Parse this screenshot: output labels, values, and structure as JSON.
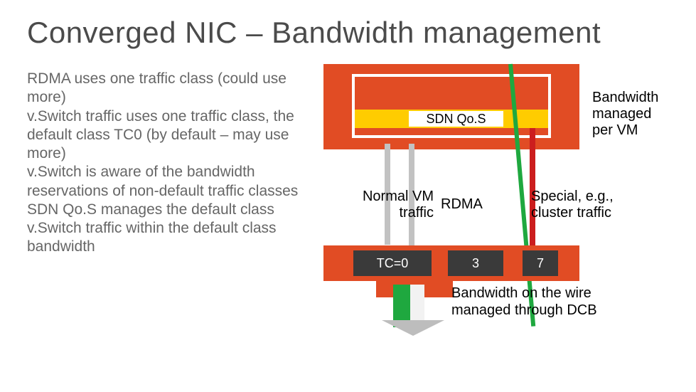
{
  "title": "Converged NIC – Bandwidth management",
  "body": {
    "p1": "RDMA uses one traffic class (could use more)",
    "p2": "v.Switch traffic uses one traffic class, the default class TC0 (by default – may use more)",
    "p3": "v.Switch is aware of the bandwidth reservations of non-default traffic classes",
    "p4": "SDN Qo.S manages the default class v.Switch traffic within the default class bandwidth"
  },
  "diagram": {
    "qos_label": "SDN Qo.S",
    "bw_per_vm_l1": "Bandwidth",
    "bw_per_vm_l2": "managed",
    "bw_per_vm_l3": "per VM",
    "normal_l1": "Normal VM",
    "normal_l2": "traffic",
    "rdma": "RDMA",
    "special_l1": "Special, e.g.,",
    "special_l2": "cluster traffic",
    "tc0": "TC=0",
    "tc3": "3",
    "tc7": "7",
    "dcb_l1": "Bandwidth on the wire",
    "dcb_l2": "managed through DCB"
  }
}
